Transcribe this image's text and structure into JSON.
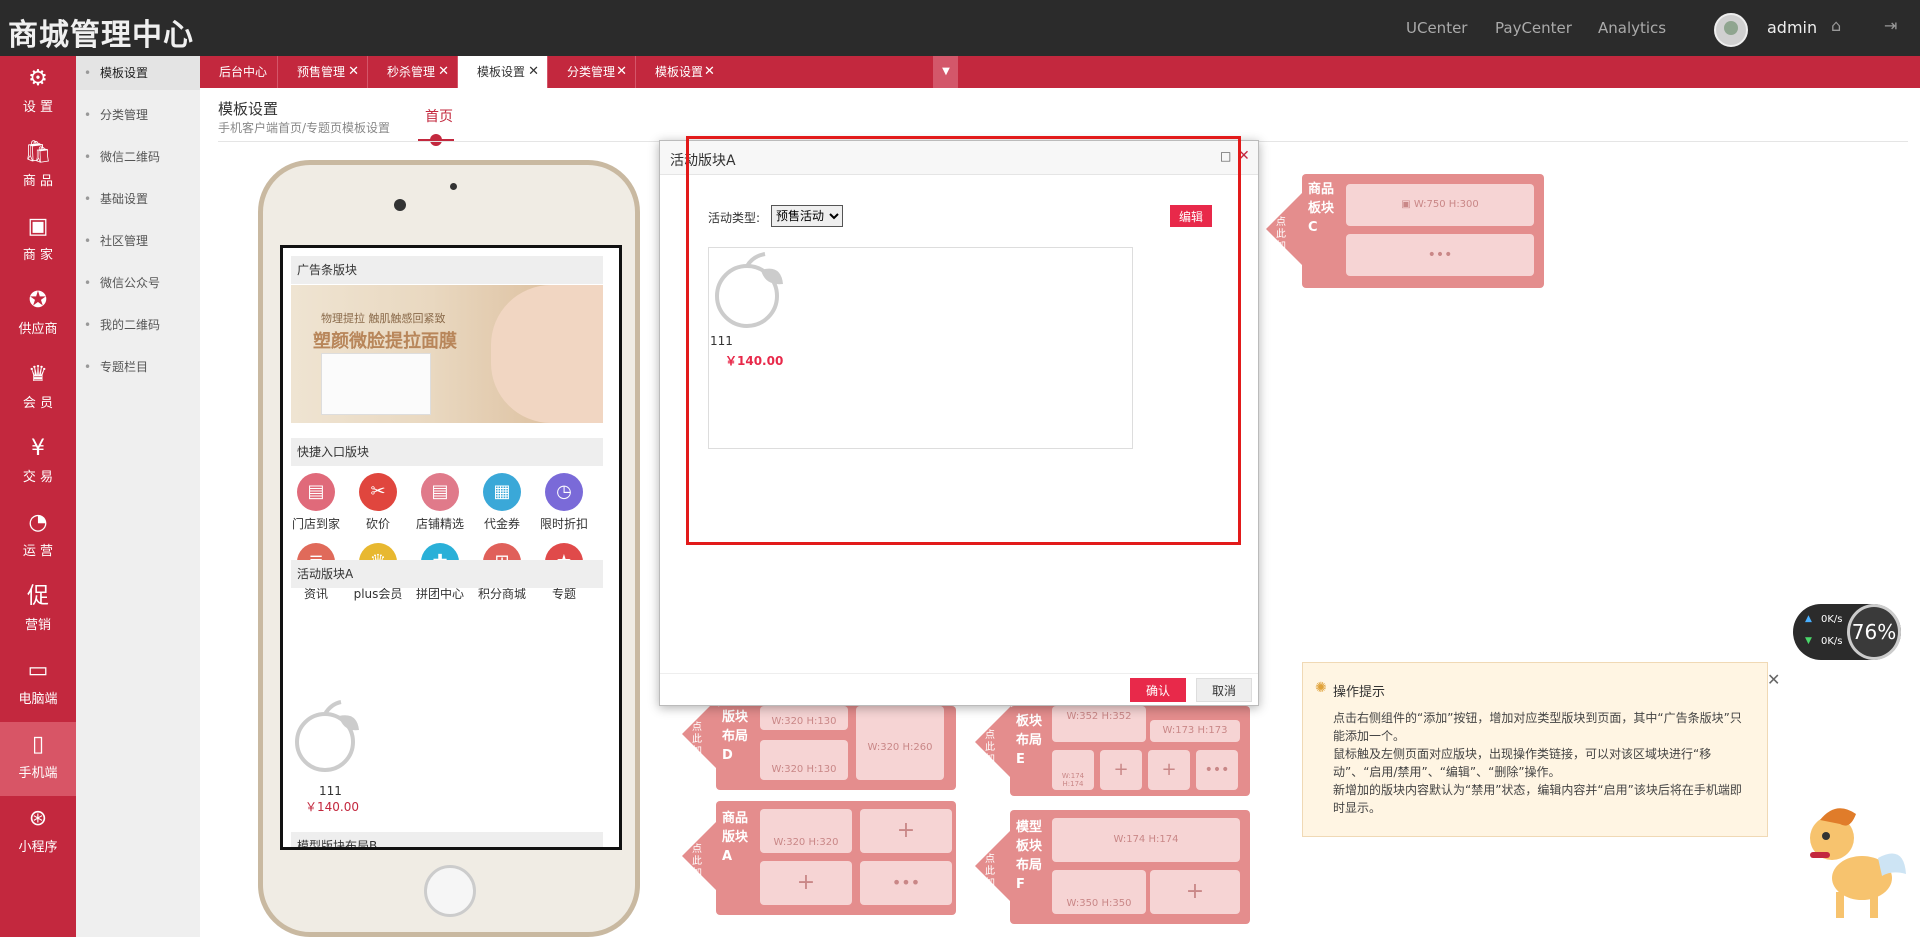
{
  "app": {
    "title": "商城管理中心"
  },
  "top_links": [
    "UCenter",
    "PayCenter",
    "Analytics"
  ],
  "user": {
    "name": "admin"
  },
  "left_nav": [
    {
      "label": "设 置",
      "icon": "gear-icon",
      "glyph": "⚙"
    },
    {
      "label": "商 品",
      "icon": "shopping-bag-icon",
      "glyph": "🛍"
    },
    {
      "label": "商 家",
      "icon": "store-icon",
      "glyph": "▣"
    },
    {
      "label": "供应商",
      "icon": "award-icon",
      "glyph": "✪"
    },
    {
      "label": "会 员",
      "icon": "crown-icon",
      "glyph": "♛"
    },
    {
      "label": "交 易",
      "icon": "yen-icon",
      "glyph": "¥"
    },
    {
      "label": "运 营",
      "icon": "pie-chart-icon",
      "glyph": "◔"
    },
    {
      "label": "营销",
      "icon": "promo-icon",
      "glyph": "促"
    },
    {
      "label": "电脑端",
      "icon": "monitor-icon",
      "glyph": "▭"
    },
    {
      "label": "手机端",
      "icon": "mobile-icon",
      "glyph": "▯"
    },
    {
      "label": "小程序",
      "icon": "mini-program-icon",
      "glyph": "⊛"
    }
  ],
  "sub_nav": [
    "模板设置",
    "分类管理",
    "微信二维码",
    "基础设置",
    "社区管理",
    "微信公众号",
    "我的二维码",
    "专题栏目"
  ],
  "tabs": [
    {
      "label": "后台中心",
      "closable": false
    },
    {
      "label": "预售管理",
      "closable": true
    },
    {
      "label": "秒杀管理",
      "closable": true
    },
    {
      "label": "模板设置",
      "closable": true
    },
    {
      "label": "分类管理",
      "closable": true
    },
    {
      "label": "模板设置",
      "closable": true
    }
  ],
  "page": {
    "title": "模板设置",
    "subtitle": "手机客户端首页/专题页模板设置",
    "home_tab": "首页"
  },
  "phone": {
    "ad_section": "广告条版块",
    "ad_text_small": "物理提拉 触肌触感回紧致",
    "ad_text_big": "塑颜微脸提拉面膜",
    "quick_section": "快捷入口版块",
    "quick_items": [
      {
        "label": "门店到家",
        "color": "#e06a7a",
        "glyph": "▤"
      },
      {
        "label": "砍价",
        "color": "#e0463e",
        "glyph": "✂"
      },
      {
        "label": "店铺精选",
        "color": "#e07a8a",
        "glyph": "▤"
      },
      {
        "label": "代金券",
        "color": "#3aa8d8",
        "glyph": "▦"
      },
      {
        "label": "限时折扣",
        "color": "#7a6ad8",
        "glyph": "◷"
      },
      {
        "label": "资讯",
        "color": "#e06a5a",
        "glyph": "≣"
      },
      {
        "label": "plus会员",
        "color": "#e8b830",
        "glyph": "♛"
      },
      {
        "label": "拼团中心",
        "color": "#2ab0d8",
        "glyph": "✚"
      },
      {
        "label": "积分商城",
        "color": "#e0605a",
        "glyph": "⊞"
      },
      {
        "label": "专题",
        "color": "#e04a4a",
        "glyph": "★"
      }
    ],
    "activity_section": "活动版块A",
    "activity_item_name": "111",
    "activity_item_price": "￥140.00",
    "model_section": "模型版块布局B"
  },
  "right_blocks": {
    "add_here": "点此加入",
    "c_name": "商品板块C",
    "c_dim": "W:750 H:300",
    "d_name": "版块布局D",
    "e_name": "板块布局E",
    "a_name": "商品版块A",
    "f_name": "模型板块布局F",
    "d_dims": [
      "W:320 H:130",
      "W:320 H:130",
      "W:320 H:260"
    ],
    "e_dims": [
      "W:352 H:352",
      "W:173 H:173",
      "W:174 H:174"
    ],
    "a_dims": [
      "W:320 H:320"
    ],
    "f_dims": [
      "W:174 H:174",
      "W:350 H:350"
    ],
    "more": "•••",
    "plus": "+"
  },
  "tips": {
    "title": "操作提示",
    "lines": [
      "点击右侧组件的“添加”按钮，增加对应类型版块到页面，其中“广告条版块”只能添加一个。",
      "鼠标触及左侧页面对应版块，出现操作类链接，可以对该区域块进行“移动”、“启用/禁用”、“编辑”、“删除”操作。",
      "新增加的版块内容默认为“禁用”状态，编辑内容并“启用”该块后将在手机端即时显示。"
    ]
  },
  "network": {
    "up": "0K/s",
    "down": "0K/s",
    "percent": "76%"
  },
  "dialog": {
    "title": "活动版块A",
    "type_label": "活动类型:",
    "type_value": "预售活动",
    "edit": "编辑",
    "product_name": "111",
    "product_price": "￥140.00",
    "ok": "确认",
    "cancel": "取消"
  }
}
